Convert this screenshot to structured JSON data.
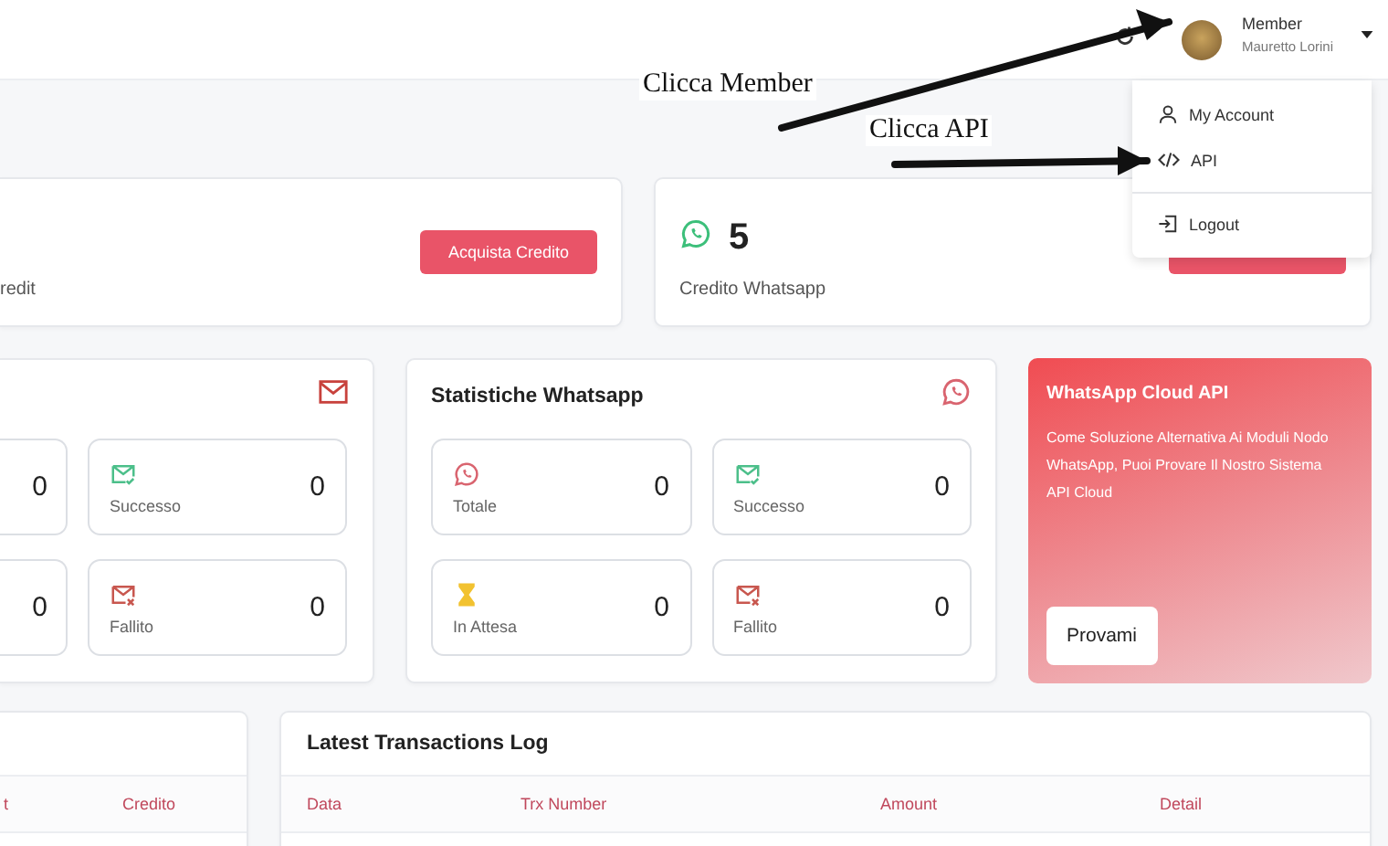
{
  "header": {
    "user": {
      "role": "Member",
      "name": "Mauretto Lorini"
    }
  },
  "user_menu": {
    "items": [
      {
        "label": "My Account",
        "kind": "account"
      },
      {
        "label": "API",
        "kind": "api"
      },
      {
        "label": "Logout",
        "kind": "logout"
      }
    ]
  },
  "annotations": [
    {
      "text": "Clicca Member"
    },
    {
      "text": "Clicca API"
    }
  ],
  "credit_cards": [
    {
      "label": "redit",
      "button": "Acquista Credito",
      "kind": "plain"
    },
    {
      "value": "5",
      "label": "Credito Whatsapp",
      "kind": "whatsapp"
    }
  ],
  "email_stats": {
    "tiles": [
      {
        "value": "0",
        "kind": "plain"
      },
      {
        "kind": "success",
        "label": "Successo",
        "value": "0"
      },
      {
        "value": "0",
        "kind": "plain"
      },
      {
        "kind": "failed",
        "label": "Fallito",
        "value": "0"
      }
    ]
  },
  "whatsapp_stats": {
    "title": "Statistiche Whatsapp",
    "tiles": [
      {
        "kind": "total",
        "label": "Totale",
        "value": "0"
      },
      {
        "kind": "success",
        "label": "Successo",
        "value": "0"
      },
      {
        "kind": "pending",
        "label": "In Attesa",
        "value": "0"
      },
      {
        "kind": "failed",
        "label": "Fallito",
        "value": "0"
      }
    ]
  },
  "promo": {
    "title": "WhatsApp Cloud API",
    "text": "Come Soluzione Alternativa Ai Moduli Nodo WhatsApp, Puoi Provare Il Nostro Sistema API Cloud",
    "button": "Provami"
  },
  "credit_table": {
    "columns": [
      "t",
      "Credito"
    ]
  },
  "transactions": {
    "title": "Latest Transactions Log",
    "columns": [
      "Data",
      "Trx Number",
      "Amount",
      "Detail"
    ]
  }
}
